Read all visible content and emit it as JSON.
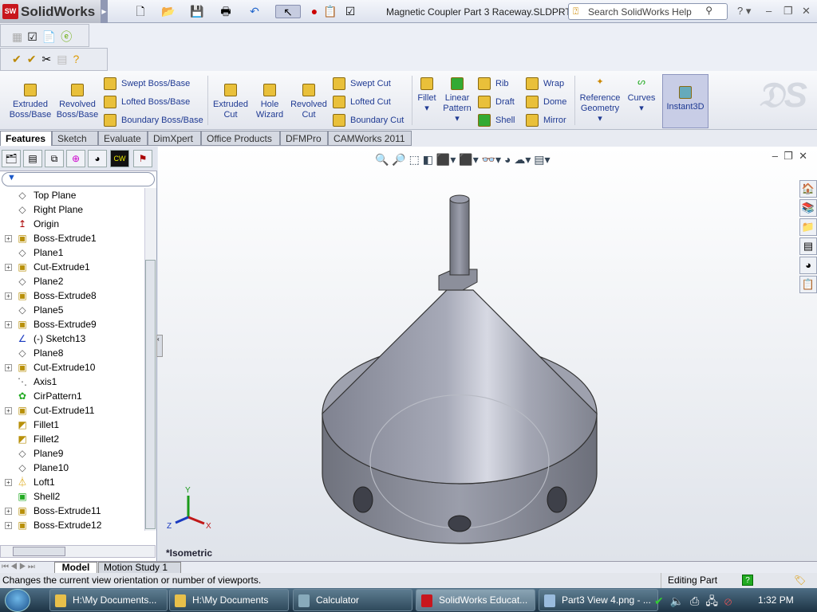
{
  "app": {
    "name": "SolidWorks",
    "logo_text": "SW",
    "document_title": "Magnetic Coupler Part 3 Raceway.SLDPRT",
    "search_placeholder": "Search SolidWorks Help"
  },
  "command_manager": {
    "features": [
      {
        "label": "Extruded Boss/Base"
      },
      {
        "label": "Revolved Boss/Base"
      },
      {
        "label": "Swept Boss/Base"
      },
      {
        "label": "Lofted Boss/Base"
      },
      {
        "label": "Boundary Boss/Base"
      },
      {
        "label": "Extruded Cut"
      },
      {
        "label": "Hole Wizard"
      },
      {
        "label": "Revolved Cut"
      },
      {
        "label": "Swept Cut"
      },
      {
        "label": "Lofted Cut"
      },
      {
        "label": "Boundary Cut"
      },
      {
        "label": "Fillet"
      },
      {
        "label": "Linear Pattern"
      },
      {
        "label": "Rib"
      },
      {
        "label": "Draft"
      },
      {
        "label": "Shell"
      },
      {
        "label": "Wrap"
      },
      {
        "label": "Dome"
      },
      {
        "label": "Mirror"
      },
      {
        "label": "Reference Geometry"
      },
      {
        "label": "Curves"
      },
      {
        "label": "Instant3D"
      }
    ],
    "tabs": [
      "Features",
      "Sketch",
      "Evaluate",
      "DimXpert",
      "Office Products",
      "DFMPro",
      "CAMWorks 2011"
    ],
    "active_tab": "Features"
  },
  "feature_tree": {
    "items": [
      {
        "label": "Top Plane",
        "icon": "plane-icon",
        "expandable": false
      },
      {
        "label": "Right Plane",
        "icon": "plane-icon",
        "expandable": false
      },
      {
        "label": "Origin",
        "icon": "origin-icon",
        "expandable": false
      },
      {
        "label": "Boss-Extrude1",
        "icon": "extrude-icon",
        "expandable": true
      },
      {
        "label": "Plane1",
        "icon": "plane-icon",
        "expandable": false
      },
      {
        "label": "Cut-Extrude1",
        "icon": "extrude-icon",
        "expandable": true
      },
      {
        "label": "Plane2",
        "icon": "plane-icon",
        "expandable": false
      },
      {
        "label": "Boss-Extrude8",
        "icon": "extrude-icon",
        "expandable": true
      },
      {
        "label": "Plane5",
        "icon": "plane-icon",
        "expandable": false
      },
      {
        "label": "Boss-Extrude9",
        "icon": "extrude-icon",
        "expandable": true
      },
      {
        "label": "(-) Sketch13",
        "icon": "sketch-icon",
        "expandable": false
      },
      {
        "label": "Plane8",
        "icon": "plane-icon",
        "expandable": false
      },
      {
        "label": "Cut-Extrude10",
        "icon": "extrude-icon",
        "expandable": true
      },
      {
        "label": "Axis1",
        "icon": "axis-icon",
        "expandable": false
      },
      {
        "label": "CirPattern1",
        "icon": "pattern-icon",
        "expandable": false
      },
      {
        "label": "Cut-Extrude11",
        "icon": "extrude-icon",
        "expandable": true
      },
      {
        "label": "Fillet1",
        "icon": "fillet-icon",
        "expandable": false
      },
      {
        "label": "Fillet2",
        "icon": "fillet-icon",
        "expandable": false
      },
      {
        "label": "Plane9",
        "icon": "plane-icon",
        "expandable": false
      },
      {
        "label": "Plane10",
        "icon": "plane-icon",
        "expandable": false
      },
      {
        "label": "Loft1",
        "icon": "loft-icon",
        "expandable": true
      },
      {
        "label": "Shell2",
        "icon": "shell-icon",
        "expandable": false
      },
      {
        "label": "Boss-Extrude11",
        "icon": "extrude-icon",
        "expandable": true
      },
      {
        "label": "Boss-Extrude12",
        "icon": "extrude-icon",
        "expandable": true
      }
    ]
  },
  "viewport": {
    "view_label": "*Isometric",
    "triad": {
      "x": "X",
      "y": "Y",
      "z": "Z"
    }
  },
  "bottom_tabs": [
    "Model",
    "Motion Study 1"
  ],
  "status": {
    "message": "Changes the current view orientation or number of viewports.",
    "mode": "Editing Part"
  },
  "taskbar": {
    "tasks": [
      "H:\\My Documents...",
      "H:\\My Documents",
      "Calculator",
      "SolidWorks Educat...",
      "Part3 View 4.png - ..."
    ],
    "active_task": "SolidWorks Educat...",
    "clock": "1:32 PM"
  }
}
